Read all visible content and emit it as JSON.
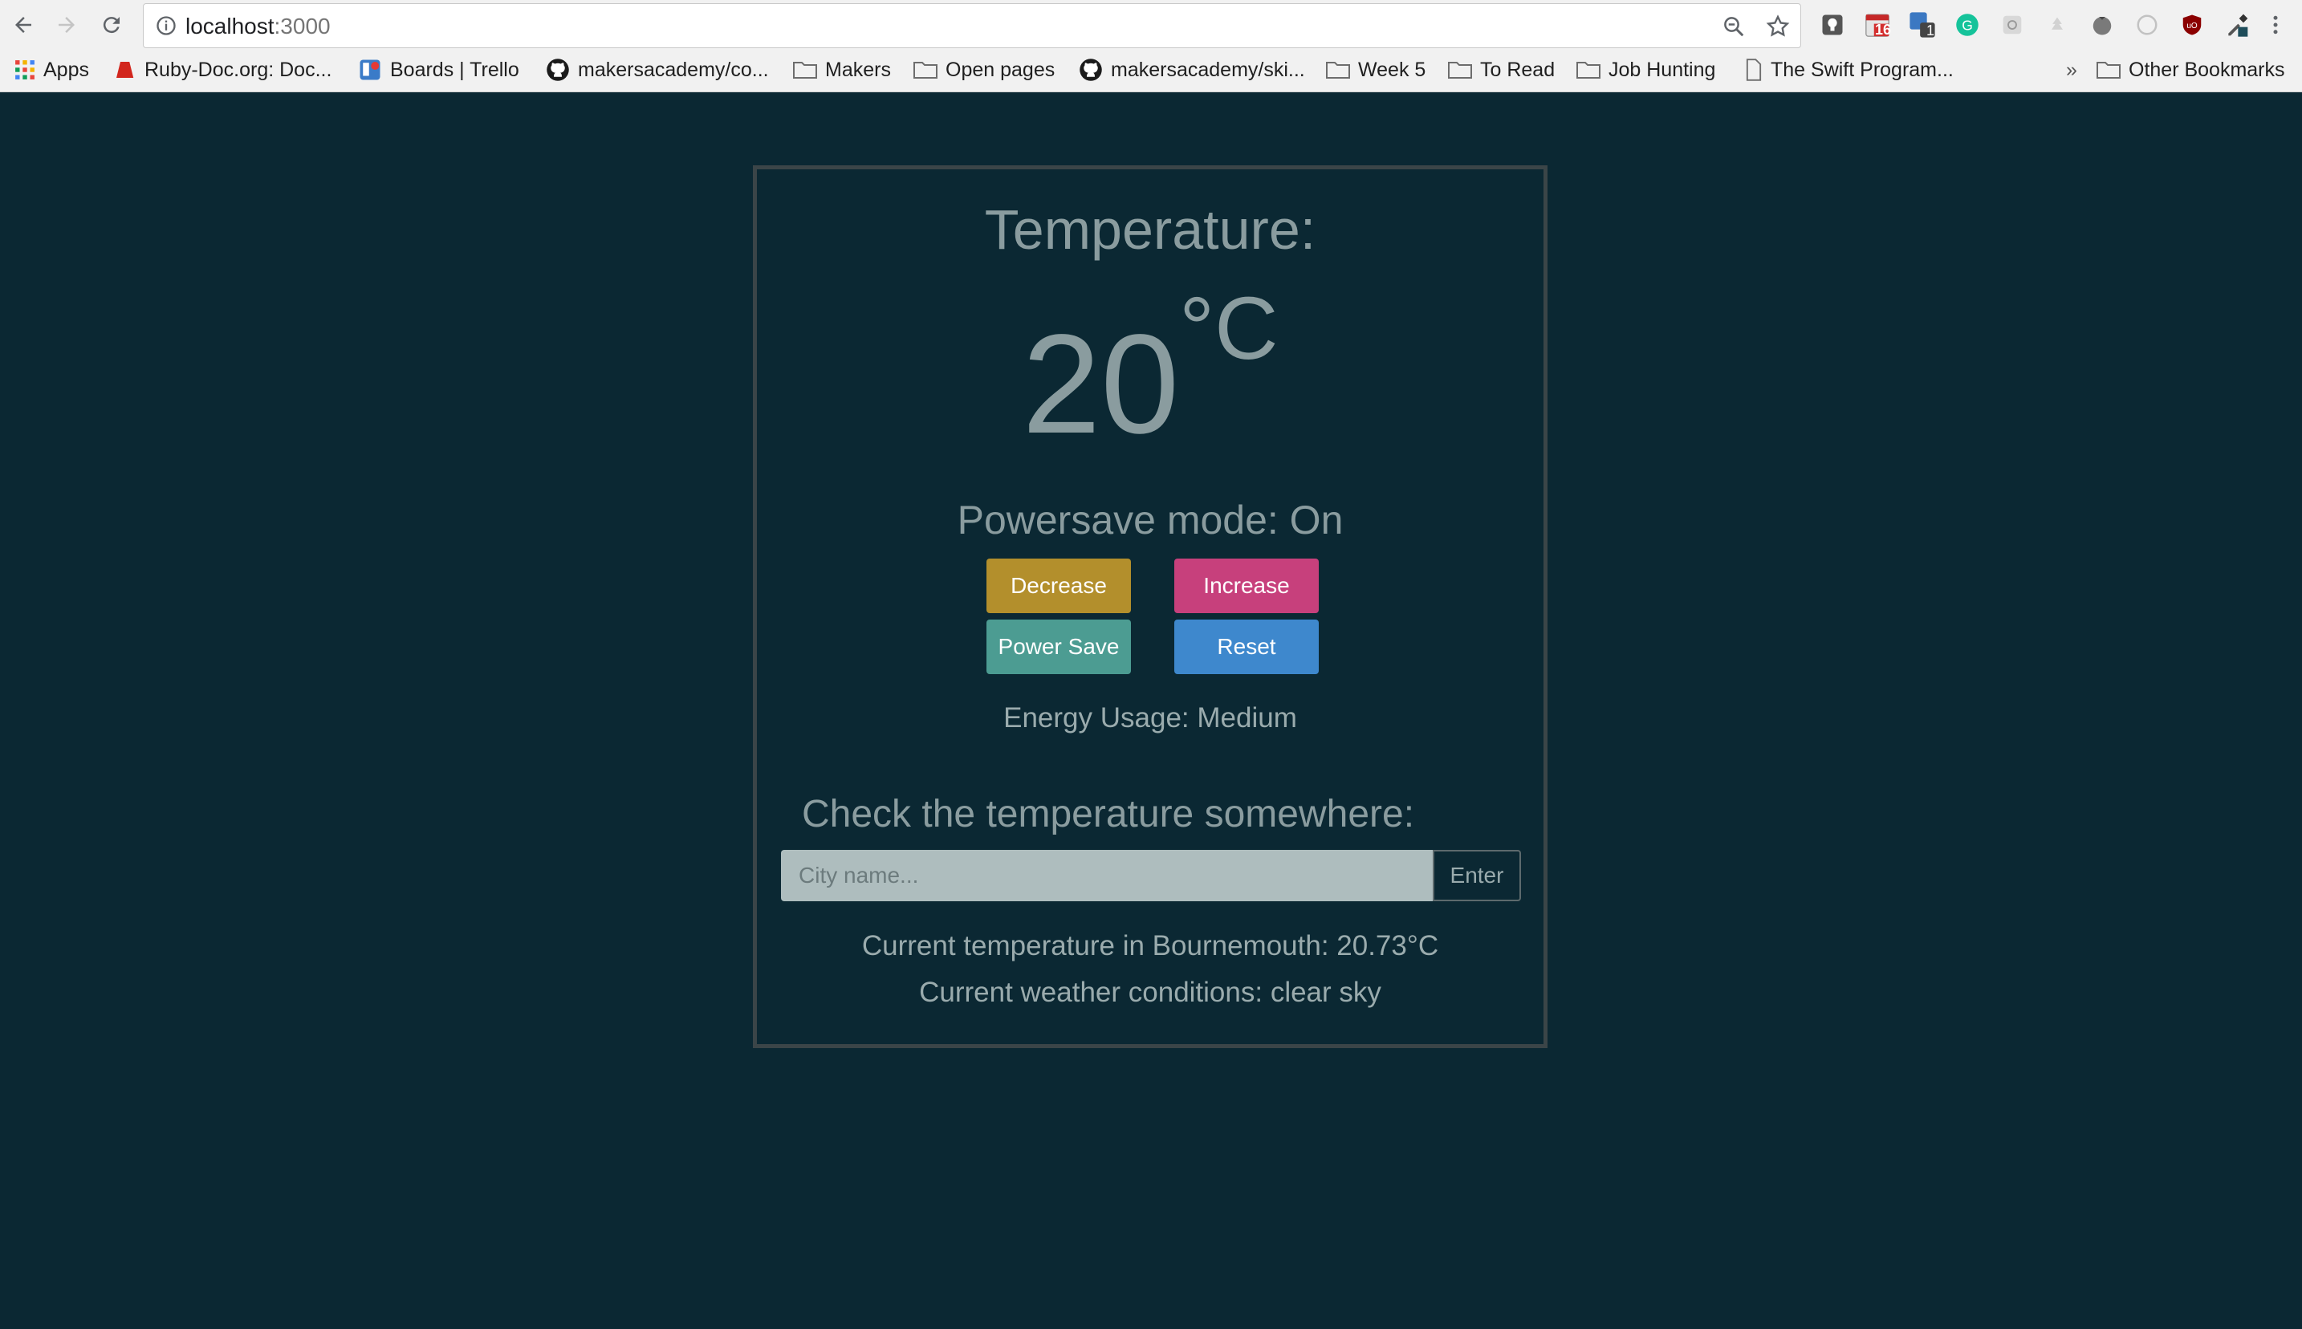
{
  "browser": {
    "url_host": "localhost",
    "url_port": ":3000",
    "extensions": {
      "calendar_badge": "16",
      "sync_badge": "1"
    },
    "bookmarks": [
      {
        "label": "Apps",
        "icon": "apps-grid-icon"
      },
      {
        "label": "Ruby-Doc.org: Doc...",
        "icon": "ruby-icon"
      },
      {
        "label": "Boards | Trello",
        "icon": "trello-icon"
      },
      {
        "label": "makersacademy/co...",
        "icon": "github-icon"
      },
      {
        "label": "Makers",
        "icon": "folder-icon"
      },
      {
        "label": "Open pages",
        "icon": "folder-icon"
      },
      {
        "label": "makersacademy/ski...",
        "icon": "github-icon"
      },
      {
        "label": "Week 5",
        "icon": "folder-icon"
      },
      {
        "label": "To Read",
        "icon": "folder-icon"
      },
      {
        "label": "Job Hunting",
        "icon": "folder-icon"
      },
      {
        "label": "The Swift Program...",
        "icon": "page-icon"
      }
    ],
    "overflow_label": "»",
    "other_bookmarks": "Other Bookmarks"
  },
  "app": {
    "heading": "Temperature:",
    "temperature": "20",
    "unit": "°C",
    "powersave_mode": "Powersave mode: On",
    "buttons": {
      "decrease": "Decrease",
      "increase": "Increase",
      "power_save": "Power Save",
      "reset": "Reset"
    },
    "energy_usage": "Energy Usage: Medium",
    "check_heading": "Check the temperature somewhere:",
    "city_placeholder": "City name...",
    "enter_label": "Enter",
    "current_temp_line": "Current temperature in Bournemouth: 20.73°C",
    "conditions_line": "Current weather conditions: clear sky"
  },
  "colors": {
    "background": "#0b2833",
    "decrease": "#b38f2c",
    "increase": "#c7407c",
    "power_save": "#4c9c92",
    "reset": "#3e88cd"
  }
}
